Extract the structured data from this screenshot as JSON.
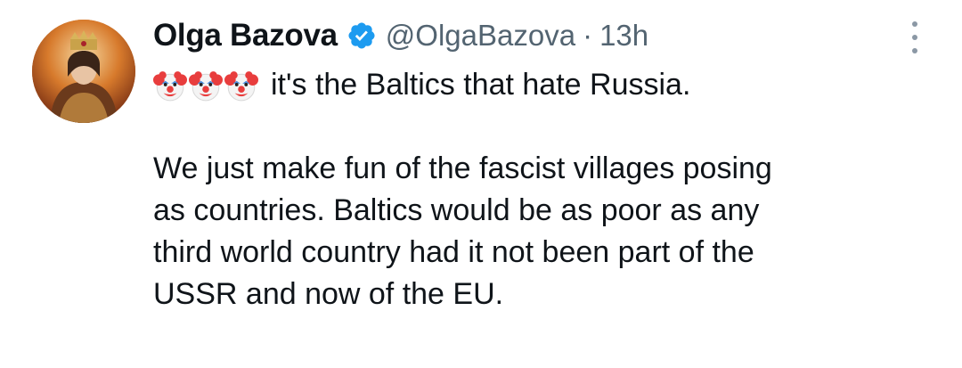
{
  "tweet": {
    "author": {
      "display_name": "Olga Bazova",
      "handle": "@OlgaBazova",
      "verified": true,
      "avatar": "avatar-image"
    },
    "separator": "·",
    "timestamp": "13h",
    "more_icon": "more-vertical-icon",
    "text": {
      "emojis": [
        "clown-face-icon",
        "clown-face-icon",
        "clown-face-icon"
      ],
      "first_line": "it's the Baltics that hate Russia.",
      "paragraph_lines": [
        "We just make fun of the fascist villages posing",
        "as countries. Baltics would be as poor as any",
        "third world country had it not been part of the",
        "USSR and now of the EU."
      ]
    }
  },
  "colors": {
    "text_primary": "#0f1419",
    "text_secondary": "#536471",
    "verified_blue": "#1d9bf0"
  }
}
